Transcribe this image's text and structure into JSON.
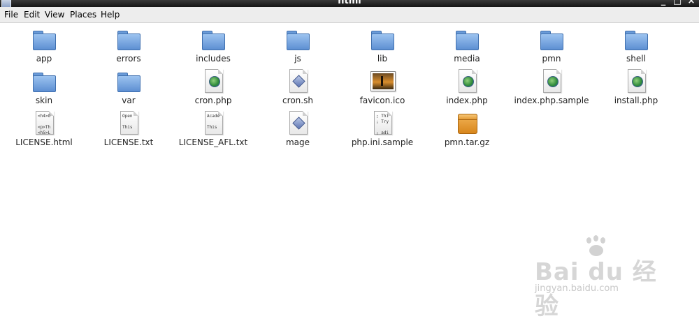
{
  "window": {
    "title": "html"
  },
  "menu": [
    {
      "label": "File"
    },
    {
      "label": "Edit"
    },
    {
      "label": "View"
    },
    {
      "label": "Places"
    },
    {
      "label": "Help"
    }
  ],
  "files": [
    {
      "name": "app",
      "icon": "folder-icon"
    },
    {
      "name": "errors",
      "icon": "folder-icon"
    },
    {
      "name": "includes",
      "icon": "folder-icon"
    },
    {
      "name": "js",
      "icon": "folder-icon"
    },
    {
      "name": "lib",
      "icon": "folder-icon"
    },
    {
      "name": "media",
      "icon": "folder-icon"
    },
    {
      "name": "pmn",
      "icon": "folder-icon"
    },
    {
      "name": "shell",
      "icon": "folder-icon"
    },
    {
      "name": "skin",
      "icon": "folder-icon"
    },
    {
      "name": "var",
      "icon": "folder-icon"
    },
    {
      "name": "cron.php",
      "icon": "php-file-icon"
    },
    {
      "name": "cron.sh",
      "icon": "script-file-icon"
    },
    {
      "name": "favicon.ico",
      "icon": "image-file-icon"
    },
    {
      "name": "index.php",
      "icon": "php-file-icon"
    },
    {
      "name": "index.php.sample",
      "icon": "php-file-icon"
    },
    {
      "name": "install.php",
      "icon": "php-file-icon"
    },
    {
      "name": "LICENSE.html",
      "icon": "html-file-icon",
      "preview": "<h4>O\n\n<p>Th\n<h5>L"
    },
    {
      "name": "LICENSE.txt",
      "icon": "text-file-icon",
      "preview": "Open\n\nThis"
    },
    {
      "name": "LICENSE_AFL.txt",
      "icon": "text-file-icon",
      "preview": "Acade\n\nThis"
    },
    {
      "name": "mage",
      "icon": "script-file-icon"
    },
    {
      "name": "php.ini.sample",
      "icon": "text-file-icon",
      "preview": "; Thi\n; Try\n\n; adi"
    },
    {
      "name": "pmn.tar.gz",
      "icon": "archive-icon"
    }
  ],
  "watermark": {
    "brand": "Bai du 经验",
    "url": "jingyan.baidu.com"
  }
}
